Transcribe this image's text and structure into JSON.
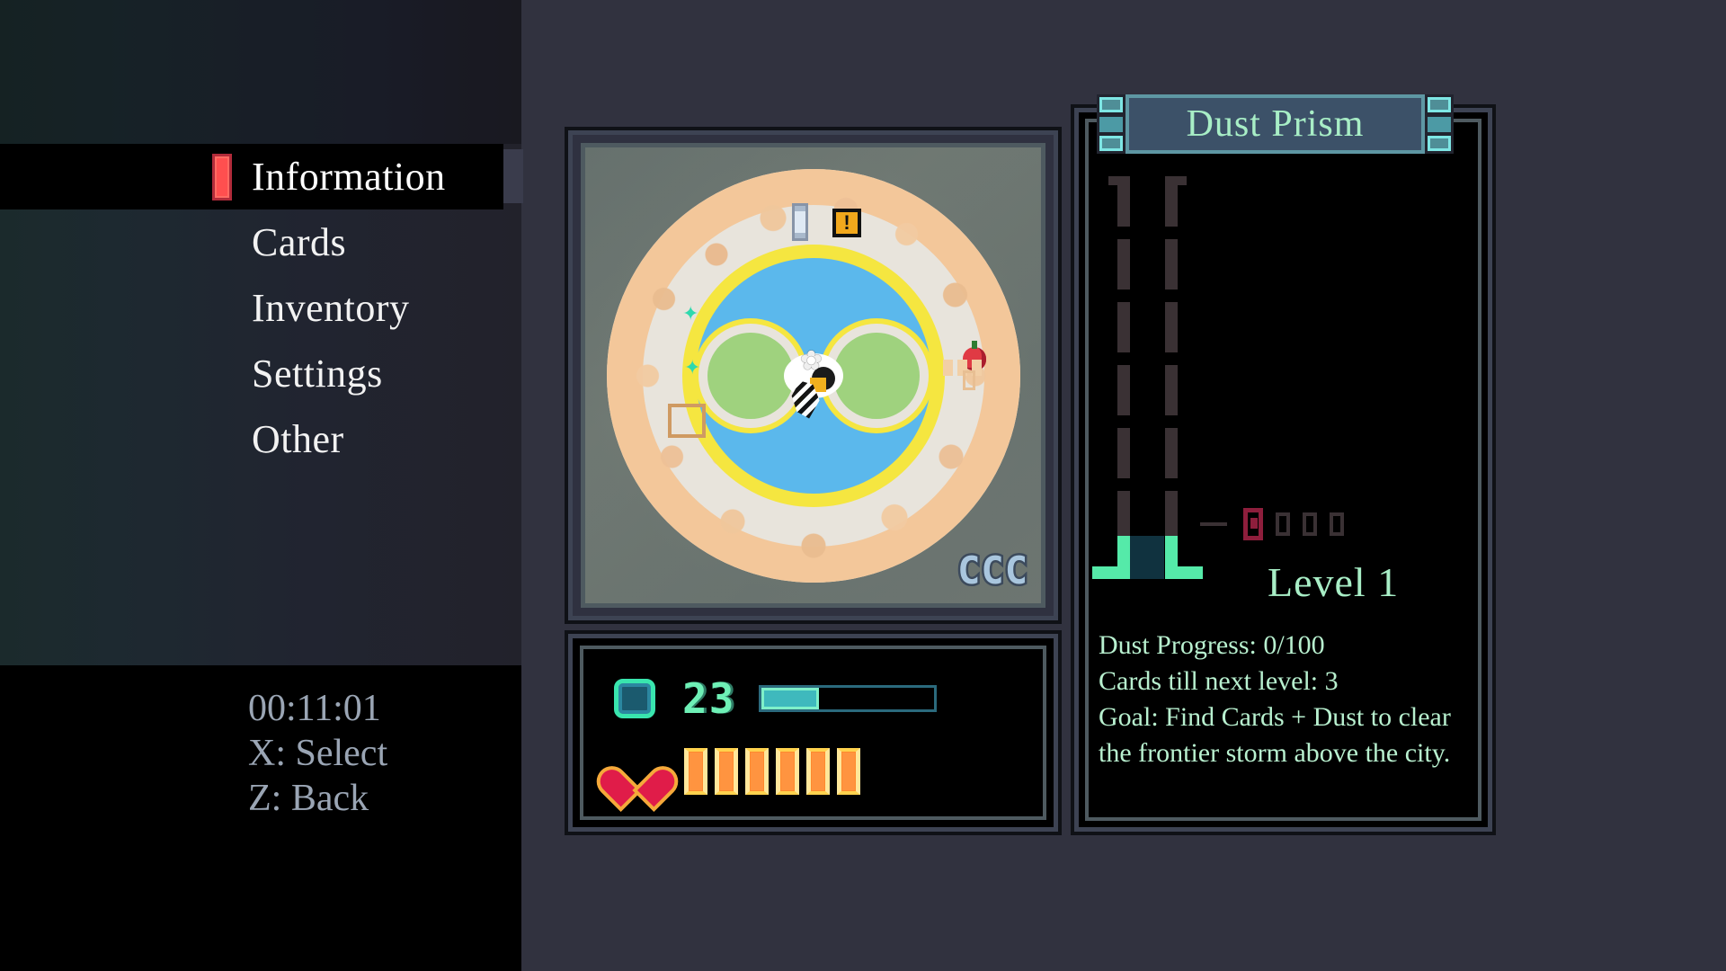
{
  "sidebar": {
    "menu_items": [
      {
        "label": "Information",
        "selected": true
      },
      {
        "label": "Cards",
        "selected": false
      },
      {
        "label": "Inventory",
        "selected": false
      },
      {
        "label": "Settings",
        "selected": false
      },
      {
        "label": "Other",
        "selected": false
      }
    ],
    "footer": {
      "timer": "00:11:01",
      "select_hint": "X: Select",
      "back_hint": "Z: Back"
    },
    "cursor_color": "#ff4f4f"
  },
  "map": {
    "tag": "CCC",
    "icons": {
      "alert": "!",
      "sparkle_left": "✦",
      "sparkle_left2": "✦",
      "player": "✿"
    }
  },
  "status": {
    "dust_icon": "dust-crystal-icon",
    "dust_count": "23",
    "dust_bar_percent": 33,
    "heart_icon": "heart-icon",
    "health_pips": 6
  },
  "prism": {
    "title": "Dust Prism",
    "level_label": "Level 1",
    "card_slots_total": 4,
    "card_slots_filled": 1,
    "lines": [
      "Dust Progress: 0/100",
      "Cards till next level: 3",
      "Goal: Find Cards + Dust to clear",
      "the frontier storm above the city."
    ],
    "accent_color": "#a8eec6",
    "panel_border_color": "#4e5a60"
  }
}
